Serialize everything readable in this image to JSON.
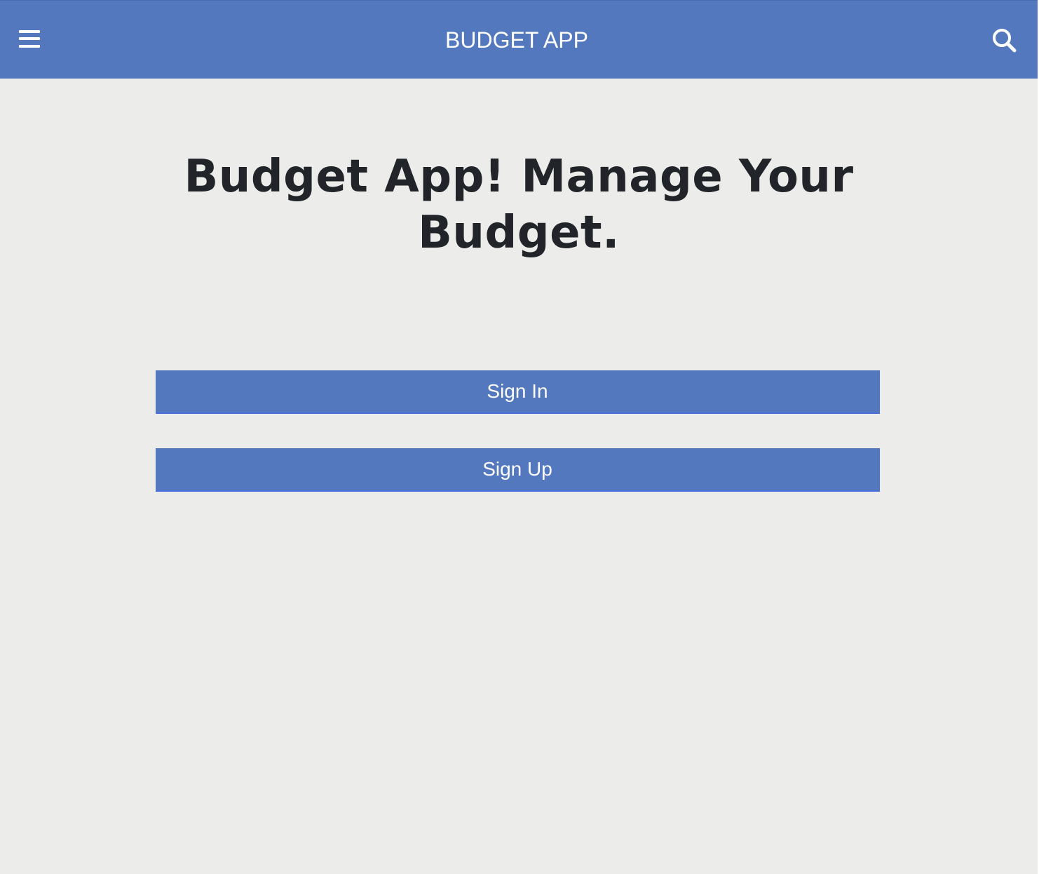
{
  "header": {
    "title": "BUDGET APP",
    "menu_icon": "hamburger-menu-icon",
    "search_icon": "search-icon"
  },
  "main": {
    "headline": "Budget App! Manage Your Budget.",
    "sign_in_label": "Sign In",
    "sign_up_label": "Sign Up"
  },
  "colors": {
    "primary": "#5378BE",
    "background": "#ECEDEA",
    "headline_text": "#212428",
    "button_text": "#FFFFFF"
  }
}
